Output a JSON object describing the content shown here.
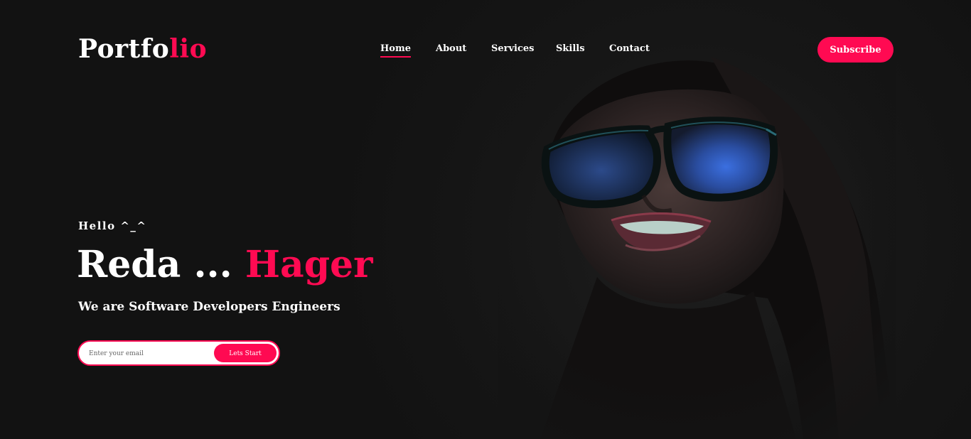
{
  "header": {
    "logo_part1": "Portfo",
    "logo_part2": "lio",
    "nav": [
      {
        "label": "Home",
        "active": true
      },
      {
        "label": "About",
        "active": false
      },
      {
        "label": "Services",
        "active": false
      },
      {
        "label": "Skills",
        "active": false
      },
      {
        "label": "Contact",
        "active": false
      }
    ],
    "subscribe_label": "Subscribe"
  },
  "hero": {
    "greeting": "Hello ^_^",
    "name_first": "Reda ...",
    "name_last": "Hager",
    "tagline": "We are Software Developers Engineers",
    "email_placeholder": "Enter your email",
    "start_label": "Lets Start"
  },
  "colors": {
    "accent": "#ff0a52",
    "background": "#141414",
    "text": "#ffffff"
  }
}
